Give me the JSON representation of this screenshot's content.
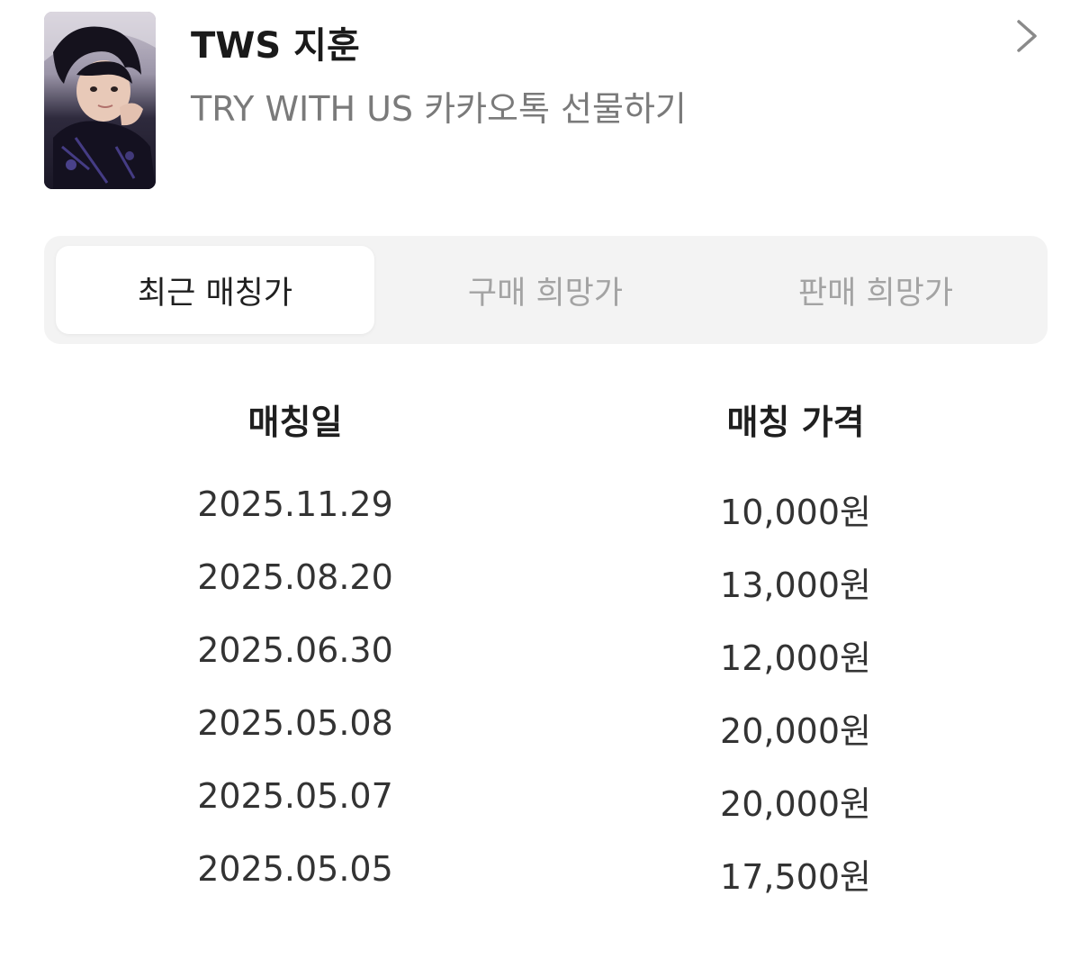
{
  "product": {
    "title": "TWS 지훈",
    "subtitle": "TRY WITH US 카카오톡 선물하기",
    "thumbnail_icon": "photocard-image",
    "chevron_icon": "chevron-right-icon"
  },
  "tabs": [
    {
      "label": "최근 매칭가",
      "active": true
    },
    {
      "label": "구매 희망가",
      "active": false
    },
    {
      "label": "판매 희망가",
      "active": false
    }
  ],
  "table": {
    "headers": {
      "date": "매칭일",
      "price": "매칭 가격"
    },
    "rows": [
      {
        "date": "2025.11.29",
        "price": "10,000원"
      },
      {
        "date": "2025.08.20",
        "price": "13,000원"
      },
      {
        "date": "2025.06.30",
        "price": "12,000원"
      },
      {
        "date": "2025.05.08",
        "price": "20,000원"
      },
      {
        "date": "2025.05.07",
        "price": "20,000원"
      },
      {
        "date": "2025.05.05",
        "price": "17,500원"
      }
    ]
  },
  "colors": {
    "active_tab_bg": "#ffffff",
    "tab_bar_bg": "#f3f3f3",
    "inactive_tab_text": "#a3a3a3",
    "subtitle_text": "#7a7a7a"
  }
}
